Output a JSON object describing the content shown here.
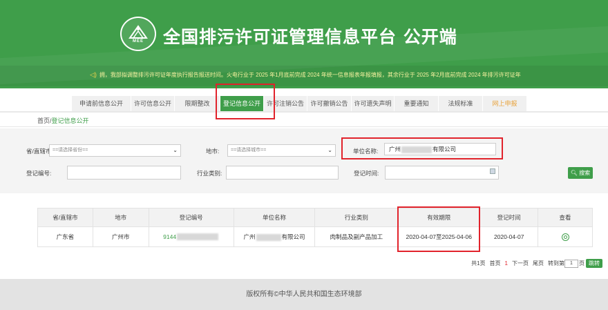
{
  "header": {
    "title": "全国排污许可证管理信息平台  公开端",
    "logo_text": "MEE",
    "notice": "拥，我部拟调整排污许可证年度执行报告报送时间。火电行业于 2025 年1月底前完成 2024 年统一信息报表年报填报，其余行业于 2025 年2月底前完成 2024 年排污许可证年"
  },
  "nav": {
    "items": [
      {
        "label": "申请前信息公开"
      },
      {
        "label": "许可信息公开"
      },
      {
        "label": "限期整改"
      },
      {
        "label": "登记信息公开",
        "active": true
      },
      {
        "label": "许可注销公告"
      },
      {
        "label": "许可撤销公告"
      },
      {
        "label": "许可遗失声明"
      },
      {
        "label": "重要通知"
      },
      {
        "label": "法规标准"
      },
      {
        "label": "网上申报"
      }
    ]
  },
  "breadcrumb": {
    "home": "首页",
    "separator": "/",
    "current": "登记信息公开"
  },
  "search": {
    "province_label": "省/直辖市:",
    "province_value": "==请选择省份==",
    "city_label": "地市:",
    "city_value": "==请选择城市==",
    "company_label": "单位名称:",
    "company_prefix": "广州",
    "company_suffix": "有限公司",
    "reg_no_label": "登记编号:",
    "industry_label": "行业类别:",
    "reg_time_label": "登记时间:",
    "search_button": "搜索"
  },
  "table": {
    "headers": [
      "省/直辖市",
      "地市",
      "登记编号",
      "单位名称",
      "行业类别",
      "有效期限",
      "登记时间",
      "查看"
    ],
    "rows": [
      {
        "province": "广东省",
        "city": "广州市",
        "reg_no_prefix": "9144",
        "company_prefix": "广州",
        "company_suffix": "有限公司",
        "industry": "肉制品及副产品加工",
        "validity": "2020-04-07至2025-04-06",
        "reg_time": "2020-04-07"
      }
    ]
  },
  "pager": {
    "total": "共1页",
    "first": "首页",
    "current": "1",
    "next": "下一页",
    "last": "尾页",
    "goto": "转到第",
    "page_value": "1",
    "page_unit": "页",
    "jump": "跳转"
  },
  "footer": {
    "copyright": "版权所有©中华人民共和国生态环境部"
  },
  "colors": {
    "brand_green": "#3f9e4a",
    "highlight_red": "#e1222b"
  }
}
